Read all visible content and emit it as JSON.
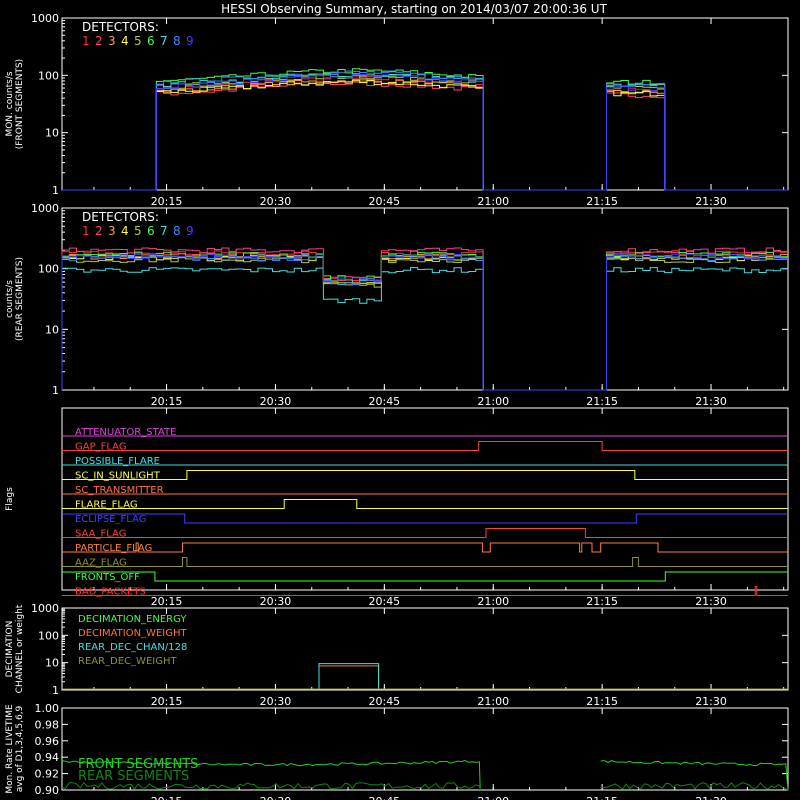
{
  "title": "HESSI Observing Summary, starting on 2014/03/07 20:00:36 UT",
  "x_axis": {
    "start_min": 0,
    "end_min": 100,
    "tick_labels": [
      "20:15",
      "20:30",
      "20:45",
      "21:00",
      "21:15",
      "21:30"
    ],
    "tick_minutes": [
      14.4,
      29.4,
      44.4,
      59.4,
      74.4,
      89.4
    ]
  },
  "detector_labels": [
    "1",
    "2",
    "3",
    "4",
    "5",
    "6",
    "7",
    "8",
    "9"
  ],
  "colors": {
    "det": [
      "#ff3030",
      "#ff4080",
      "#ff9a3c",
      "#ffff40",
      "#b8c830",
      "#40ff40",
      "#40e0e0",
      "#3a8aff",
      "#4040ff"
    ],
    "axis": "#ffffff",
    "front_live": "#20d020",
    "rear_live": "#108810"
  },
  "chart_data": [
    {
      "type": "line",
      "id": "front",
      "ylabel": "MON. counts/s\n(FRONT SEGMENTS)",
      "legend_title": "DETECTORS:",
      "yscale": "log",
      "ylim": [
        1,
        1000
      ],
      "ytick_labels": [
        "1",
        "10",
        "100",
        "1000"
      ],
      "ytick_values": [
        1,
        10,
        100,
        1000
      ],
      "segments": [
        [
          12.5,
          57.6
        ],
        [
          74.2,
          82.7
        ]
      ],
      "series_levels": [
        55,
        45,
        50,
        48,
        60,
        75,
        65,
        70,
        60
      ],
      "bump": 1.6
    },
    {
      "type": "line",
      "id": "rear",
      "ylabel": "counts/s\n(REAR SEGMENTS)",
      "legend_title": "DETECTORS:",
      "yscale": "log",
      "ylim": [
        1,
        1000
      ],
      "ytick_labels": [
        "1",
        "10",
        "100",
        "1000"
      ],
      "ytick_values": [
        1,
        10,
        100,
        1000
      ],
      "segments": [
        [
          0,
          57.6
        ],
        [
          74.2,
          100
        ]
      ],
      "attenuator_dip": [
        35.4,
        43.6
      ],
      "series_levels": [
        180,
        200,
        160,
        150,
        140,
        170,
        95,
        150,
        160
      ],
      "dip_levels": [
        70,
        75,
        65,
        60,
        55,
        70,
        30,
        60,
        65
      ]
    },
    {
      "type": "flags",
      "id": "flags",
      "ylabel": "Flags",
      "flags": [
        {
          "name": "ATTENUATOR_STATE",
          "color": "#e040e0",
          "transitions": []
        },
        {
          "name": "GAP_FLAG",
          "color": "#ff4040",
          "transitions": [
            [
              57.4,
              74.4
            ]
          ]
        },
        {
          "name": "POSSIBLE_FLARE",
          "color": "#40e0e0",
          "transitions": []
        },
        {
          "name": "SC_IN_SUNLIGHT",
          "color": "#ffff40",
          "transitions": [
            [
              17.2,
              78.9
            ]
          ]
        },
        {
          "name": "SC_TRANSMITTER",
          "color": "#ff7040",
          "transitions": []
        },
        {
          "name": "FLARE_FLAG",
          "color": "#ffff40",
          "transitions": [
            [
              30.6,
              40.6
            ]
          ]
        },
        {
          "name": "ECLIPSE_FLAG",
          "color": "#4040ff",
          "inverted": true,
          "transitions": [
            [
              16.9,
              79.1
            ]
          ]
        },
        {
          "name": "SAA_FLAG",
          "color": "#ff4040",
          "transitions": [
            [
              58.4,
              72.1
            ]
          ]
        },
        {
          "name": "PARTICLE_FLAG",
          "color": "#ff8040",
          "transitions": [
            [
              10.2,
              10.5
            ],
            [
              16.6,
              57.9
            ],
            [
              59.0,
              71.3
            ],
            [
              71.6,
              73.0
            ],
            [
              74.2,
              82.1
            ]
          ]
        },
        {
          "name": "AAZ_FLAG",
          "color": "#909030",
          "transitions": [
            [
              16.6,
              17.2
            ],
            [
              78.6,
              79.4
            ]
          ]
        },
        {
          "name": "FRONTS_OFF",
          "color": "#40ff40",
          "inverted": true,
          "transitions": [
            [
              12.8,
              83.1
            ]
          ]
        },
        {
          "name": "BAD_PACKETS",
          "color": "#ff3030",
          "transitions": [
            [
              95.5,
              95.7
            ]
          ]
        }
      ]
    },
    {
      "type": "line",
      "id": "decimation",
      "ylabel": "DECIMATION\nCHANNEL or weight",
      "yscale": "log",
      "ylim": [
        1,
        1000
      ],
      "ytick_labels": [
        "1",
        "10",
        "100",
        "1000"
      ],
      "ytick_values": [
        1,
        10,
        100,
        1000
      ],
      "series": [
        {
          "name": "DECIMATION_ENERGY",
          "color": "#40ff40",
          "level": 1,
          "box": null
        },
        {
          "name": "DECIMATION_WEIGHT",
          "color": "#ff7040",
          "level": 1,
          "box": [
            35.4,
            43.6,
            7
          ]
        },
        {
          "name": "REAR_DEC_CHAN/128",
          "color": "#40e0e0",
          "level": 1,
          "box": [
            35.4,
            43.6,
            8.5
          ]
        },
        {
          "name": "REAR_DEC_WEIGHT",
          "color": "#909030",
          "level": 1,
          "box": null
        }
      ]
    },
    {
      "type": "line",
      "id": "livetime",
      "ylabel": "Mon. Rate LIVETIME\navg of D1,3,4,5,6,9",
      "yscale": "linear",
      "ylim": [
        0.9,
        1.0
      ],
      "ytick_labels": [
        "0.90",
        "0.92",
        "0.94",
        "0.96",
        "0.98",
        "1.00"
      ],
      "ytick_values": [
        0.9,
        0.92,
        0.94,
        0.96,
        0.98,
        1.0
      ],
      "segments": [
        [
          0,
          57.6
        ],
        [
          74.2,
          100
        ]
      ],
      "series": [
        {
          "name": "FRONT SEGMENTS",
          "color": "#20d020",
          "level": 0.935
        },
        {
          "name": "REAR SEGMENTS",
          "color": "#108810",
          "level": 0.905
        }
      ]
    }
  ]
}
